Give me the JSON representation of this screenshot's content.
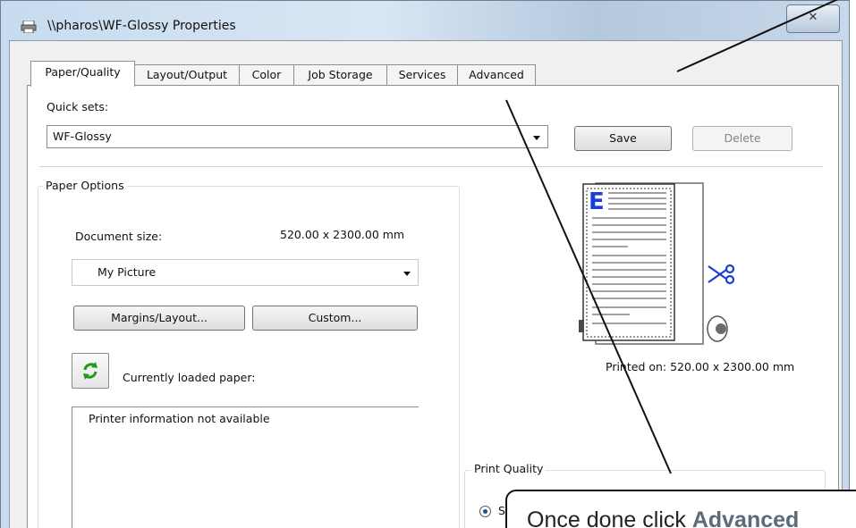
{
  "window": {
    "title": "\\\\pharos\\WF-Glossy Properties",
    "close_glyph": "✕"
  },
  "tabs": [
    {
      "label": "Paper/Quality",
      "active": true
    },
    {
      "label": "Layout/Output",
      "active": false
    },
    {
      "label": "Color",
      "active": false
    },
    {
      "label": "Job Storage",
      "active": false
    },
    {
      "label": "Services",
      "active": false
    },
    {
      "label": "Advanced",
      "active": false
    }
  ],
  "quick_sets": {
    "label": "Quick sets:",
    "value": "WF-Glossy",
    "save_label": "Save",
    "delete_label": "Delete"
  },
  "paper_options": {
    "title": "Paper Options",
    "doc_size_label": "Document size:",
    "doc_size_value": "520.00 x 2300.00 mm",
    "size_select_value": "My Picture",
    "margins_button": "Margins/Layout...",
    "custom_button": "Custom...",
    "loaded_paper_label": "Currently loaded paper:",
    "printer_info": "Printer information not available"
  },
  "preview": {
    "letter": "E",
    "printed_on": "Printed on: 520.00 x 2300.00 mm"
  },
  "print_quality": {
    "title": "Print Quality",
    "first_option_partial": "S"
  },
  "annotation": {
    "prefix": "Once done click ",
    "emphasis": "Advanced"
  },
  "colors": {
    "accent_blue": "#1a3fd8",
    "refresh_green": "#1f9a1f"
  }
}
